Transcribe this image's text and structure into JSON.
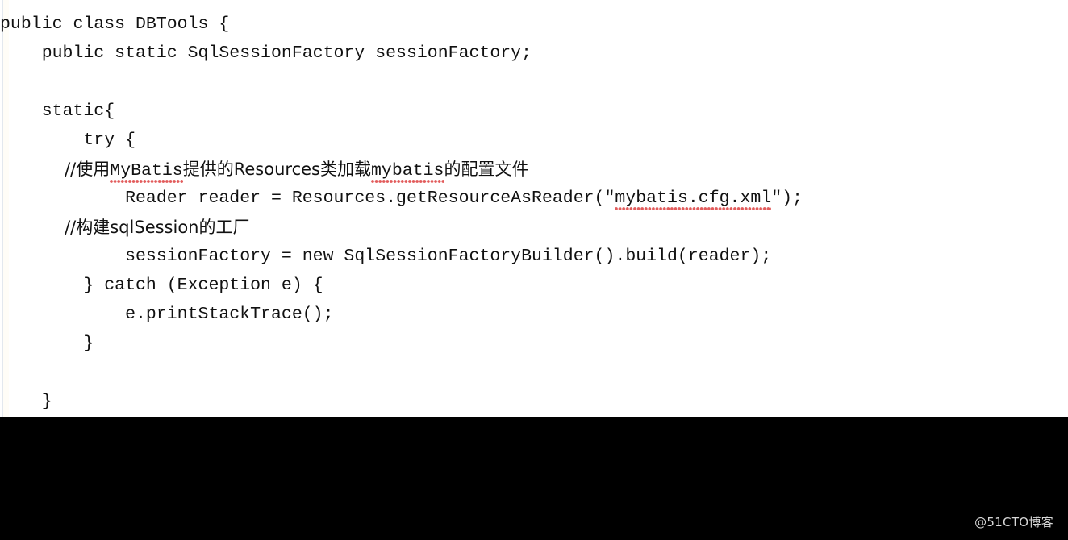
{
  "page": {
    "background_color": "#ffffff",
    "footer_color": "#000000",
    "code_text_color": "#111111",
    "squiggle_color": "#e25c5c"
  },
  "code": {
    "language": "java",
    "lines": [
      {
        "indent": 0,
        "text": "public class DBTools {"
      },
      {
        "indent": 4,
        "text": "public static SqlSessionFactory sessionFactory;"
      },
      {
        "indent": 0,
        "text": ""
      },
      {
        "indent": 4,
        "text": "static{"
      },
      {
        "indent": 8,
        "text": "try {"
      },
      {
        "indent": 12,
        "text": "//使用MyBatis提供的Resources类加载mybatis的配置文件"
      },
      {
        "indent": 12,
        "text": "Reader reader = Resources.getResourceAsReader(\"mybatis.cfg.xml\");"
      },
      {
        "indent": 12,
        "text": "//构建sqlSession的工厂"
      },
      {
        "indent": 12,
        "text": "sessionFactory = new SqlSessionFactoryBuilder().build(reader);"
      },
      {
        "indent": 8,
        "text": "} catch (Exception e) {"
      },
      {
        "indent": 12,
        "text": "e.printStackTrace();"
      },
      {
        "indent": 8,
        "text": "}"
      },
      {
        "indent": 0,
        "text": ""
      },
      {
        "indent": 4,
        "text": "}"
      }
    ],
    "line1": {
      "seg1": "public class DBTools {"
    },
    "line2": {
      "seg1": "    public static SqlSessionFactory sessionFactory;"
    },
    "line4": {
      "seg1": "    static{"
    },
    "line5": {
      "seg1": "        try {"
    },
    "line6": {
      "seg1": "            //使用",
      "misspelled1": "MyBatis",
      "seg2": "提供的Resources类加载",
      "misspelled2": "mybatis",
      "seg3": "的配置文件"
    },
    "line7": {
      "seg1": "            Reader reader = Resources.getResourceAsReader(\"",
      "misspelled1": "mybatis.cfg.xml",
      "seg2": "\");"
    },
    "line8": {
      "seg1": "            //构建sqlSession的工厂"
    },
    "line9": {
      "seg1": "            sessionFactory = new SqlSessionFactoryBuilder().build(reader);"
    },
    "line10": {
      "seg1": "        } catch (Exception e) {"
    },
    "line11": {
      "seg1": "            e.printStackTrace();"
    },
    "line12": {
      "seg1": "        }"
    },
    "line14": {
      "seg1": "    }"
    }
  },
  "footer": {
    "watermark": "@51CTO博客"
  }
}
